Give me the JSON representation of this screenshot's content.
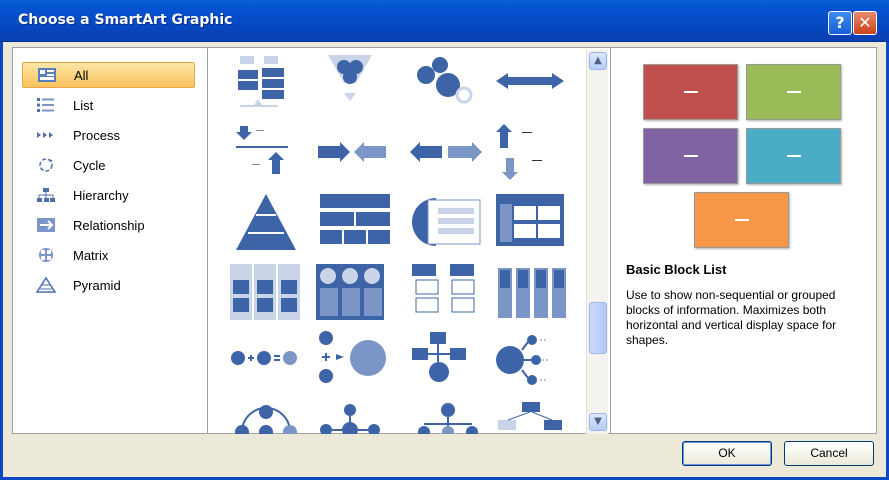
{
  "window": {
    "title": "Choose a SmartArt Graphic",
    "help_label": "?",
    "close_label": "✕"
  },
  "categories": [
    {
      "label": "All",
      "icon": "all-icon",
      "selected": true
    },
    {
      "label": "List",
      "icon": "list-icon"
    },
    {
      "label": "Process",
      "icon": "process-icon"
    },
    {
      "label": "Cycle",
      "icon": "cycle-icon"
    },
    {
      "label": "Hierarchy",
      "icon": "hierarchy-icon"
    },
    {
      "label": "Relationship",
      "icon": "relationship-icon"
    },
    {
      "label": "Matrix",
      "icon": "matrix-icon"
    },
    {
      "label": "Pyramid",
      "icon": "pyramid-icon"
    }
  ],
  "preview": {
    "title": "Basic Block List",
    "description": "Use to show non-sequential or grouped blocks of information. Maximizes both horizontal and vertical display space for shapes.",
    "block_colors": [
      "#c0504d",
      "#9bbb59",
      "#8064a2",
      "#4bacc6",
      "#f79646"
    ]
  },
  "buttons": {
    "ok": "OK",
    "cancel": "Cancel"
  },
  "colors": {
    "accent_blue": "#3c64a6",
    "selection": "#f9c25a"
  }
}
